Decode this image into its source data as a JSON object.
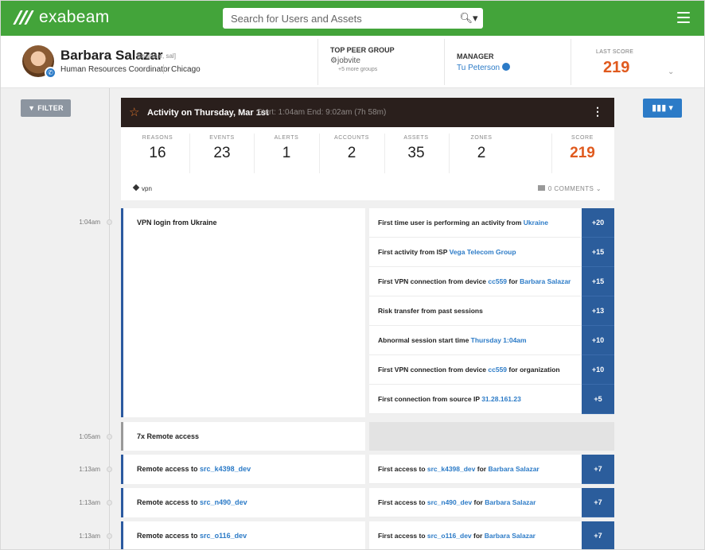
{
  "app": {
    "logo": "exabeam",
    "search_placeholder": "Search for Users and Assets"
  },
  "user": {
    "name": "Barbara Salazar",
    "handle": "[bsalazar, sal]",
    "title": "Human Resources Coordinator",
    "city": "Chicago",
    "peer_group_label": "TOP PEER GROUP",
    "peer_group_value": "jobvite",
    "peer_group_more": "+5 more groups",
    "manager_label": "MANAGER",
    "manager_value": "Tu Peterson",
    "last_score_label": "LAST SCORE",
    "last_score_value": "219"
  },
  "toolbar": {
    "filter_label": "FILTER",
    "chart_label": "▾"
  },
  "activity": {
    "title": "Activity on Thursday, Mar 1st",
    "range": "Start: 1:04am End: 9:02am (7h 58m)",
    "stats": [
      {
        "label": "REASONS",
        "value": "16"
      },
      {
        "label": "EVENTS",
        "value": "23"
      },
      {
        "label": "ALERTS",
        "value": "1"
      },
      {
        "label": "ACCOUNTS",
        "value": "2"
      },
      {
        "label": "ASSETS",
        "value": "35"
      },
      {
        "label": "ZONES",
        "value": "2"
      },
      {
        "label": "SCORE",
        "value": "219"
      }
    ],
    "tag": "vpn",
    "comments": "0 COMMENTS"
  },
  "events": [
    {
      "time": "1:04am",
      "title": "VPN login from Ukraine",
      "reasons": [
        {
          "pre": "First time user is performing an activity from ",
          "link": "Ukraine",
          "mid": "",
          "link2": "",
          "points": "+20"
        },
        {
          "pre": "First activity from ISP ",
          "link": "Vega Telecom Group",
          "mid": "",
          "link2": "",
          "points": "+15"
        },
        {
          "pre": "First VPN connection from device ",
          "link": "cc559",
          "mid": " for ",
          "link2": "Barbara Salazar",
          "points": "+15"
        },
        {
          "pre": "Risk transfer from past sessions",
          "link": "",
          "mid": "",
          "link2": "",
          "points": "+13"
        },
        {
          "pre": "Abnormal session start time ",
          "link": "Thursday 1:04am",
          "mid": "",
          "link2": "",
          "points": "+10"
        },
        {
          "pre": "First VPN connection from device ",
          "link": "cc559",
          "mid": " for organization",
          "link2": "",
          "points": "+10"
        },
        {
          "pre": "First connection from source IP ",
          "link": "31.28.161.23",
          "mid": "",
          "link2": "",
          "points": "+5"
        }
      ]
    },
    {
      "time": "1:05am",
      "title": "7x Remote access"
    },
    {
      "time": "1:13am",
      "pre": "Remote access to ",
      "asset": "src_k4398_dev",
      "reason_pre": "First access to ",
      "reason_asset": "src_k4398_dev",
      "reason_mid": " for ",
      "reason_user": "Barbara Salazar",
      "points": "+7"
    },
    {
      "time": "1:13am",
      "pre": "Remote access to ",
      "asset": "src_n490_dev",
      "reason_pre": "First access to ",
      "reason_asset": "src_n490_dev",
      "reason_mid": " for ",
      "reason_user": "Barbara Salazar",
      "points": "+7"
    },
    {
      "time": "1:13am",
      "pre": "Remote access to ",
      "asset": "src_o116_dev",
      "reason_pre": "First access to ",
      "reason_asset": "src_o116_dev",
      "reason_mid": " for ",
      "reason_user": "Barbara Salazar",
      "points": "+7"
    }
  ],
  "colors": {
    "brand_green": "#43a43a",
    "accent_blue": "#2c7bc7",
    "score_orange": "#e05a1e",
    "points_blue": "#2b5d9c"
  }
}
